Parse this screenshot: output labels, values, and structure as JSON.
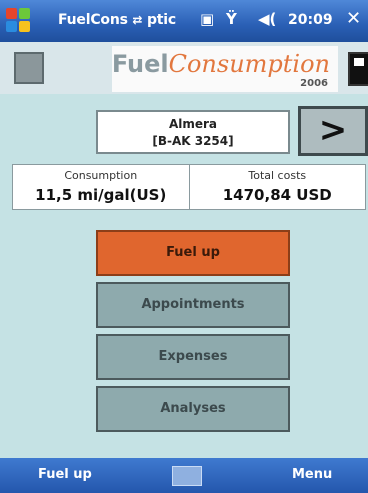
{
  "statusbar": {
    "title": "FuelCons",
    "title_suffix": "ptic",
    "time": "20:09",
    "close_glyph": "✕",
    "icons": [
      "windows-start-icon",
      "connectivity-icon",
      "signal-icon",
      "volume-icon"
    ]
  },
  "header": {
    "logo_fuel": "Fuel",
    "logo_consumption": "Consumption",
    "logo_year": "2006"
  },
  "vehicle": {
    "name": "Almera",
    "plate": "[B-AK 3254]",
    "next_glyph": ">"
  },
  "stats": {
    "consumption_label": "Consumption",
    "consumption_value": "11,5 mi/gal(US)",
    "costs_label": "Total costs",
    "costs_value": "1470,84 USD"
  },
  "menu": {
    "items": [
      {
        "label": "Fuel up",
        "active": true
      },
      {
        "label": "Appointments",
        "active": false
      },
      {
        "label": "Expenses",
        "active": false
      },
      {
        "label": "Analyses",
        "active": false
      }
    ]
  },
  "bottombar": {
    "left_label": "Fuel up",
    "right_label": "Menu"
  },
  "colors": {
    "accent": "#e0662e",
    "background": "#c5e2e4",
    "titlebar": "#2a5fb5"
  }
}
